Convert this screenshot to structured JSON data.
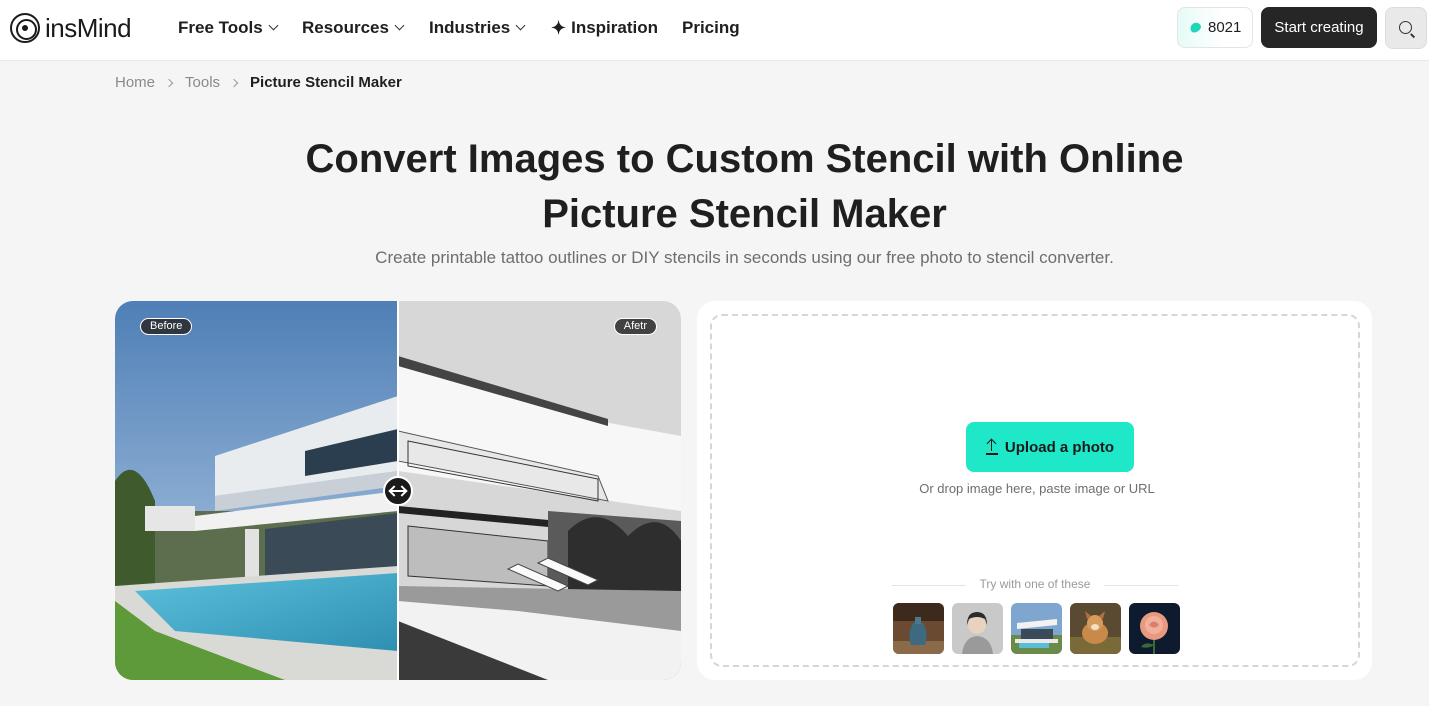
{
  "header": {
    "logo_text": "insMind",
    "nav": [
      {
        "label": "Free Tools"
      },
      {
        "label": "Resources"
      },
      {
        "label": "Industries"
      },
      {
        "label": "Inspiration"
      },
      {
        "label": "Pricing"
      }
    ],
    "credits": "8021",
    "start_label": "Start creating"
  },
  "breadcrumb": {
    "items": [
      "Home",
      "Tools",
      "Picture Stencil Maker"
    ]
  },
  "hero": {
    "title_line1": "Convert Images to Custom Stencil with Online",
    "title_line2": "Picture Stencil Maker",
    "subtitle": "Create printable tattoo outlines or DIY stencils in seconds using our free photo to stencil converter."
  },
  "compare": {
    "before_label": "Before",
    "after_label": "Afetr"
  },
  "upload": {
    "button_label": "Upload a photo",
    "hint": "Or drop image here, paste image or URL",
    "try_label": "Try with one of these",
    "samples": [
      "vase",
      "portrait",
      "house",
      "dog",
      "rose"
    ]
  },
  "colors": {
    "accent": "#1fe8c8",
    "dark_button": "#262626",
    "page_bg": "#f5f5f5"
  }
}
